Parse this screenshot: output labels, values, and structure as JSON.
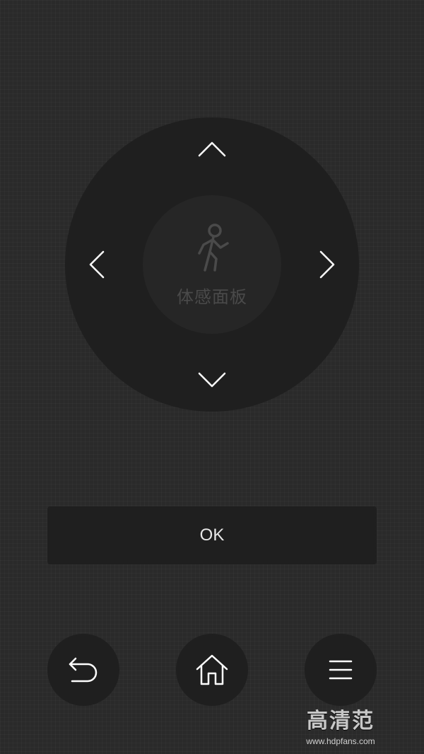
{
  "dpad": {
    "center_label": "体感面板",
    "center_icon": "running-person-icon",
    "up_icon": "chevron-up-icon",
    "down_icon": "chevron-down-icon",
    "left_icon": "chevron-left-icon",
    "right_icon": "chevron-right-icon"
  },
  "ok": {
    "label": "OK"
  },
  "bottom_bar": {
    "back_icon": "back-arrow-icon",
    "home_icon": "home-icon",
    "menu_icon": "menu-icon"
  },
  "watermark": {
    "brand": "高清范",
    "url": "www.hdpfans.com"
  },
  "colors": {
    "background": "#2a2a2a",
    "button": "#1f1f1f",
    "icon": "#ffffff",
    "center_dim": "#4a4a4a"
  }
}
